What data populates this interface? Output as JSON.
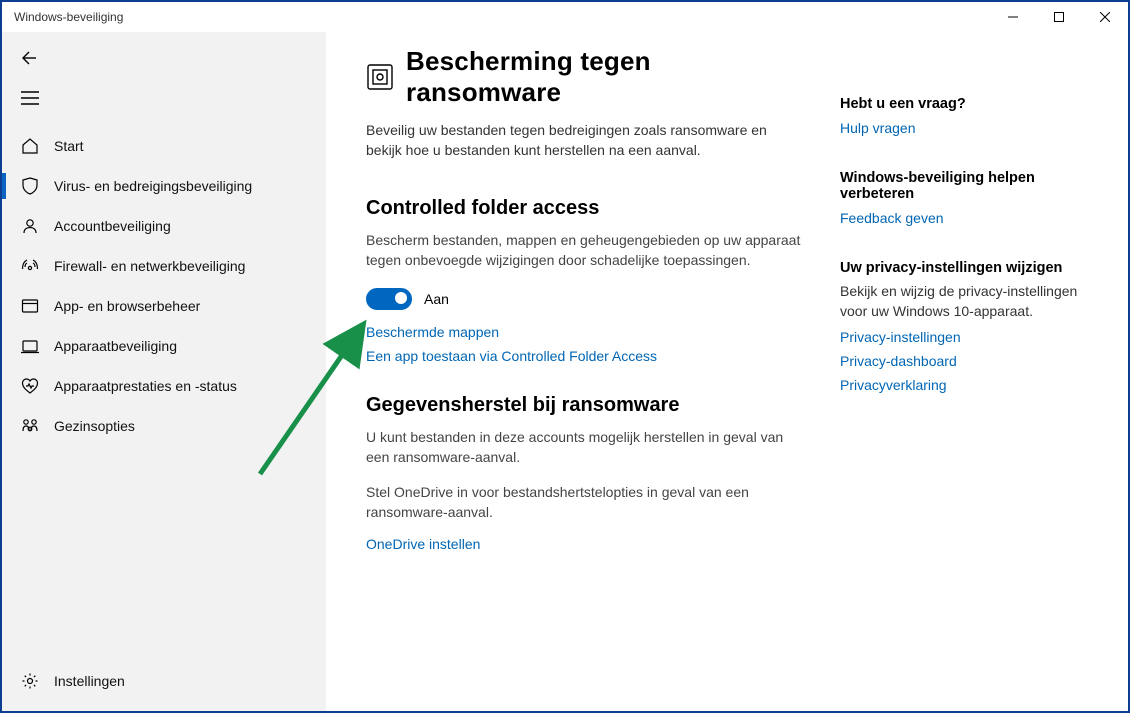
{
  "window": {
    "title": "Windows-beveiliging"
  },
  "sidebar": {
    "items": [
      {
        "id": "home",
        "label": "Start"
      },
      {
        "id": "virus",
        "label": "Virus- en bedreigingsbeveiliging"
      },
      {
        "id": "account",
        "label": "Accountbeveiliging"
      },
      {
        "id": "firewall",
        "label": "Firewall- en netwerkbeveiliging"
      },
      {
        "id": "browser",
        "label": "App- en browserbeheer"
      },
      {
        "id": "device",
        "label": "Apparaatbeveiliging"
      },
      {
        "id": "perf",
        "label": "Apparaatprestaties en -status"
      },
      {
        "id": "family",
        "label": "Gezinsopties"
      }
    ],
    "settings_label": "Instellingen"
  },
  "page": {
    "title": "Bescherming tegen ransomware",
    "lead": "Beveilig uw bestanden tegen bedreigingen zoals ransomware en bekijk hoe u bestanden kunt herstellen na een aanval.",
    "cfa": {
      "heading": "Controlled folder access",
      "desc": "Bescherm bestanden, mappen en geheugengebieden op uw apparaat tegen onbevoegde wijzigingen door schadelijke toepassingen.",
      "toggle_state": "Aan",
      "link_protected": "Beschermde mappen",
      "link_allow": "Een app toestaan via Controlled Folder Access"
    },
    "recovery": {
      "heading": "Gegevensherstel bij ransomware",
      "desc": "U kunt bestanden in deze accounts mogelijk herstellen in geval van een ransomware-aanval.",
      "onedrive_hint": "Stel OneDrive in voor bestandshertstelopties in geval van een ransomware-aanval.",
      "link_onedrive": "OneDrive instellen"
    }
  },
  "side": {
    "help": {
      "heading": "Hebt u een vraag?",
      "link": "Hulp vragen"
    },
    "feedback": {
      "heading": "Windows-beveiliging helpen verbeteren",
      "link": "Feedback geven"
    },
    "privacy": {
      "heading": "Uw privacy-instellingen wijzigen",
      "desc": "Bekijk en wijzig de privacy-instellingen voor uw Windows 10-apparaat.",
      "link1": "Privacy-instellingen",
      "link2": "Privacy-dashboard",
      "link3": "Privacyverklaring"
    }
  }
}
